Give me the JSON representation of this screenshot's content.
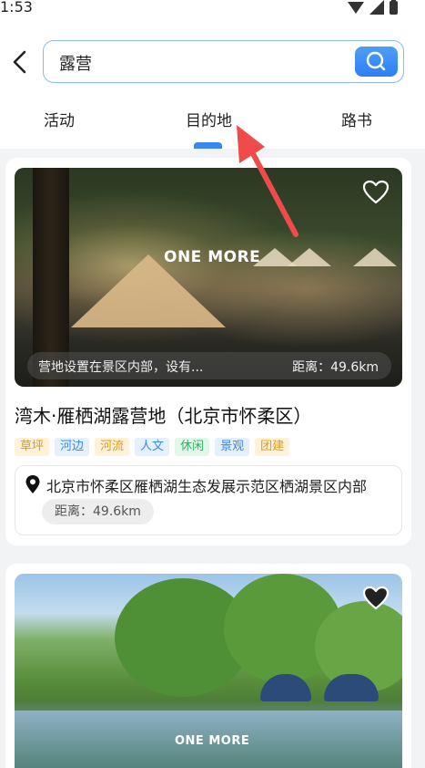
{
  "status_bar": {
    "time": "1:53"
  },
  "search": {
    "query": "露营"
  },
  "tabs": [
    {
      "label": "活动",
      "active": false
    },
    {
      "label": "目的地",
      "active": true
    },
    {
      "label": "路书",
      "active": false
    }
  ],
  "colors": {
    "accent": "#3a86f3",
    "arrow": "#f04b4b"
  },
  "cards": [
    {
      "brand": "ONE MORE",
      "image_caption": "营地设置在景区内部，设有...",
      "image_distance": "距离：49.6km",
      "title": "湾木·雁栖湖露营地（北京市怀柔区）",
      "tags": [
        "草坪",
        "河边",
        "河流",
        "人文",
        "休闲",
        "景观",
        "团建"
      ],
      "address": "北京市怀柔区雁栖湖生态发展示范区栖湖景区内部",
      "distance": "距离：49.6km"
    },
    {
      "brand": "ONE MORE"
    }
  ]
}
